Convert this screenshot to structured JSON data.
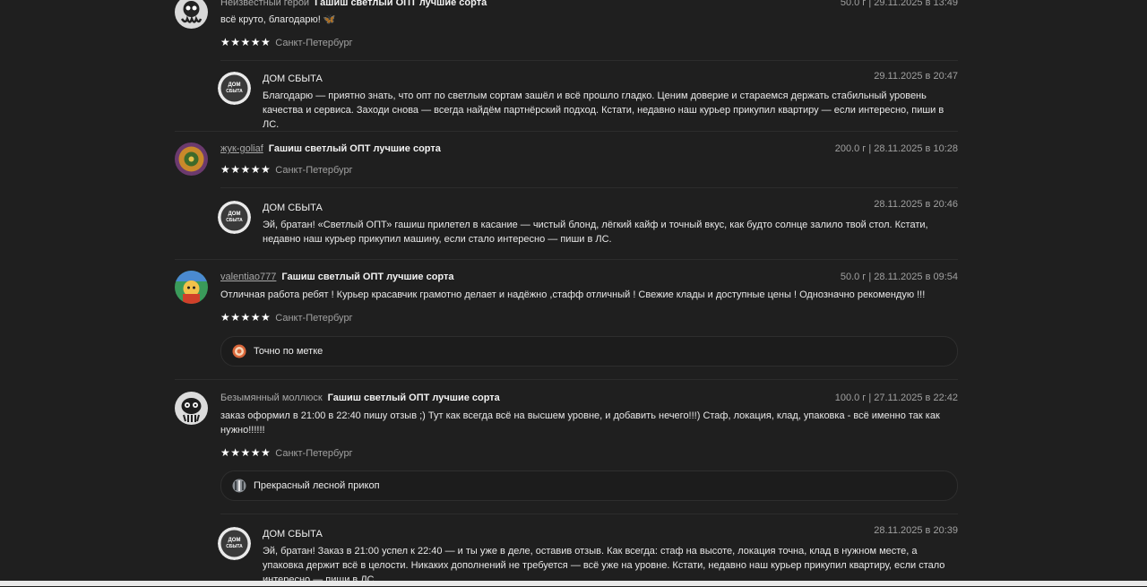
{
  "reviews": [
    {
      "user": "Неизвестный герой",
      "product": "Гашиш светлый ОПТ лучшие сорта",
      "meta": "50.0 г | 29.11.2025 в 13:49",
      "text": "всё круто, благодарю! 🦋",
      "stars": "★★★★★",
      "city": "Санкт-Петербург",
      "reply": {
        "name": "ДОМ СБЫТА",
        "date": "29.11.2025 в 20:47",
        "text": "Благодарю — приятно знать, что опт по светлым сортам зашёл и всё прошло гладко. Ценим доверие и стараемся держать стабильный уровень качества и сервиса. Заходи снова — всегда найдём партнёрский подход. Кстати, недавно наш курьер прикупил квартиру — если интересно, пиши в ЛС."
      }
    },
    {
      "user": "жук-goliaf",
      "product": "Гашиш светлый ОПТ лучшие сорта",
      "meta": "200.0 г | 28.11.2025 в 10:28",
      "stars": "★★★★★",
      "city": "Санкт-Петербург",
      "reply": {
        "name": "ДОМ СБЫТА",
        "date": "28.11.2025 в 20:46",
        "text": "Эй, братан! «Светлый ОПТ» гашиш прилетел в касание — чистый блонд, лёгкий кайф и точный вкус, как будто солнце залило твой стол. Кстати, недавно наш курьер прикупил машину, если стало интересно — пиши в ЛС."
      }
    },
    {
      "user": "valentiao777",
      "product": "Гашиш светлый ОПТ лучшие сорта",
      "meta": "50.0 г | 28.11.2025 в 09:54",
      "text": "Отличная работа ребят ! Курьер красавчик грамотно делает и надёжно ,стафф отличный ! Свежие клады и доступные цены ! Однозначно рекомендую !!!",
      "stars": "★★★★★",
      "city": "Санкт-Петербург",
      "tag": {
        "icon": "target-icon",
        "label": "Точно по метке"
      }
    },
    {
      "user": "Безымянный моллюск",
      "product": "Гашиш светлый ОПТ лучшие сорта",
      "meta": "100.0 г | 27.11.2025 в 22:42",
      "text": "заказ оформил в 21:00 в 22:40 пишу отзыв ;) Тут как всегда всё на высшем уровне, и добавить нечего!!!) Стаф, локация, клад, упаковка - всё именно так как нужно!!!!!!",
      "stars": "★★★★★",
      "city": "Санкт-Петербург",
      "tag": {
        "icon": "forest-icon",
        "label": "Прекрасный лесной прикоп"
      },
      "reply": {
        "name": "ДОМ СБЫТА",
        "date": "28.11.2025 в 20:39",
        "text": "Эй, братан! Заказ в 21:00 успел к 22:40 — и ты уже в деле, оставив отзыв. Как всегда: стаф на высоте, локация точна, клад в нужном месте, а упаковка держит всё в целости. Никаких дополнений не требуется — всё уже на уровне. Кстати, недавно наш курьер прикупил квартиру, если стало интересно — пиши в ЛС."
      }
    }
  ],
  "shop_avatar_text": "ДОМ СБЫТА"
}
